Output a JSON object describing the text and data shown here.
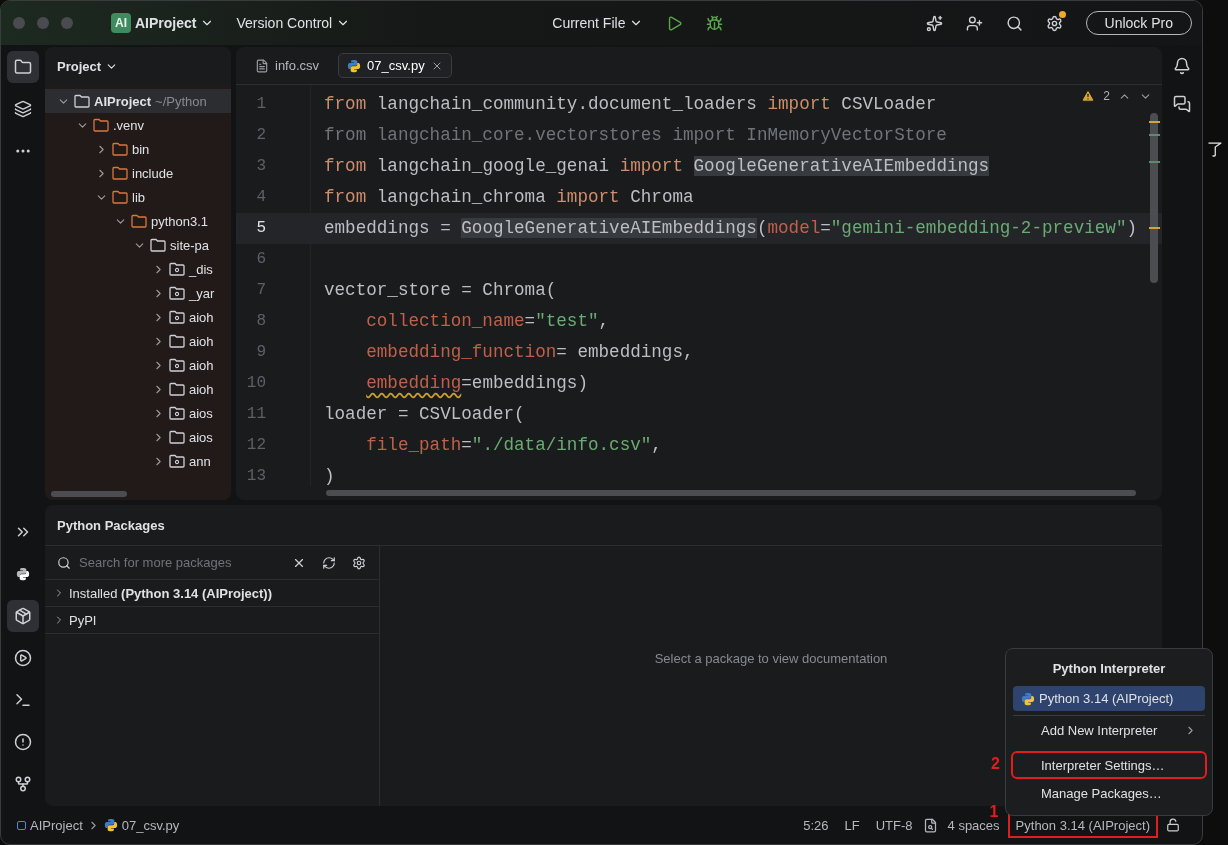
{
  "titlebar": {
    "project_badge": "AI",
    "project": "AIProject",
    "vcs": "Version Control",
    "run_config": "Current File",
    "unlock": "Unlock Pro",
    "settings_notice": true
  },
  "left_tools_top": [
    {
      "selected": true
    },
    {
      "selected": false
    },
    {
      "selected": false
    }
  ],
  "left_tools_bottom": [
    {
      "selected": false
    },
    {
      "selected": false
    },
    {
      "selected": true
    },
    {
      "selected": false
    },
    {
      "selected": false
    },
    {
      "selected": false
    },
    {
      "selected": false
    }
  ],
  "project": {
    "title": "Project",
    "tree": [
      {
        "name": "AIProject",
        "hint": "~/Python",
        "kind": "folder",
        "bold": true,
        "selected": true,
        "expanded": true,
        "children": [
          {
            "name": ".venv",
            "kind": "excluded",
            "bold": false,
            "selected": false,
            "expanded": true,
            "children": [
              {
                "name": "bin",
                "kind": "excluded",
                "bold": false,
                "selected": false,
                "expanded": false
              },
              {
                "name": "include",
                "kind": "excluded",
                "bold": false,
                "selected": false,
                "expanded": false
              },
              {
                "name": "lib",
                "kind": "excluded",
                "bold": false,
                "selected": false,
                "expanded": true,
                "children": [
                  {
                    "name": "python3.1",
                    "kind": "excluded",
                    "bold": false,
                    "selected": false,
                    "expanded": true,
                    "children": [
                      {
                        "name": "site-pa",
                        "kind": "folder",
                        "bold": false,
                        "selected": false,
                        "expanded": true,
                        "children": [
                          {
                            "name": "_dis",
                            "kind": "package",
                            "bold": false,
                            "selected": false,
                            "expanded": false
                          },
                          {
                            "name": "_yar",
                            "kind": "package",
                            "bold": false,
                            "selected": false,
                            "expanded": false
                          },
                          {
                            "name": "aioh",
                            "kind": "package",
                            "bold": false,
                            "selected": false,
                            "expanded": false
                          },
                          {
                            "name": "aioh",
                            "kind": "folder",
                            "bold": false,
                            "selected": false,
                            "expanded": false
                          },
                          {
                            "name": "aioh",
                            "kind": "package",
                            "bold": false,
                            "selected": false,
                            "expanded": false
                          },
                          {
                            "name": "aioh",
                            "kind": "folder",
                            "bold": false,
                            "selected": false,
                            "expanded": false
                          },
                          {
                            "name": "aios",
                            "kind": "package",
                            "bold": false,
                            "selected": false,
                            "expanded": false
                          },
                          {
                            "name": "aios",
                            "kind": "folder",
                            "bold": false,
                            "selected": false,
                            "expanded": false
                          },
                          {
                            "name": "ann",
                            "kind": "package",
                            "bold": false,
                            "selected": false,
                            "expanded": false
                          }
                        ]
                      }
                    ]
                  }
                ]
              }
            ]
          }
        ]
      }
    ]
  },
  "editor": {
    "tabs": [
      {
        "label": "info.csv",
        "kind": "text",
        "selected": false
      },
      {
        "label": "07_csv.py",
        "kind": "python",
        "selected": true
      }
    ],
    "warnings": "2",
    "lines": [
      {
        "number": "1",
        "current": false,
        "tokens": [
          {
            "kind": "keyword",
            "text": "from "
          },
          {
            "kind": "plain",
            "text": "langchain_community.document_loaders "
          },
          {
            "kind": "keyword",
            "text": "import "
          },
          {
            "kind": "plain",
            "text": "CSVLoader"
          }
        ]
      },
      {
        "number": "2",
        "current": false,
        "tokens": [
          {
            "kind": "unused",
            "text": "from langchain_core.vectorstores import InMemoryVectorStore"
          }
        ]
      },
      {
        "number": "3",
        "current": false,
        "tokens": [
          {
            "kind": "keyword",
            "text": "from "
          },
          {
            "kind": "plain",
            "text": "langchain_google_genai "
          },
          {
            "kind": "keyword",
            "text": "import "
          },
          {
            "kind": "highlight",
            "text": "GoogleGenerativeAIEmbeddings"
          }
        ]
      },
      {
        "number": "4",
        "current": false,
        "tokens": [
          {
            "kind": "keyword",
            "text": "from "
          },
          {
            "kind": "plain",
            "text": "langchain_chroma "
          },
          {
            "kind": "keyword",
            "text": "import "
          },
          {
            "kind": "plain",
            "text": "Chroma"
          }
        ]
      },
      {
        "number": "5",
        "current": true,
        "tokens": [
          {
            "kind": "plain",
            "text": "embeddings = "
          },
          {
            "kind": "highlight",
            "text": "GoogleGenerativeAIEmbeddings"
          },
          {
            "kind": "plain",
            "text": "("
          },
          {
            "kind": "param",
            "text": "model"
          },
          {
            "kind": "plain",
            "text": "="
          },
          {
            "kind": "string",
            "text": "\"gemini-embedding-2-preview\""
          },
          {
            "kind": "plain",
            "text": ")"
          }
        ]
      },
      {
        "number": "6",
        "current": false
      },
      {
        "number": "7",
        "current": false,
        "tokens": [
          {
            "kind": "plain",
            "text": "vector_store = Chroma("
          }
        ]
      },
      {
        "number": "8",
        "current": false,
        "tokens": [
          {
            "kind": "param",
            "text": "    collection_name"
          },
          {
            "kind": "plain",
            "text": "="
          },
          {
            "kind": "string",
            "text": "\"test\""
          },
          {
            "kind": "plain",
            "text": ","
          }
        ]
      },
      {
        "number": "9",
        "current": false,
        "tokens": [
          {
            "kind": "param",
            "text": "    embedding_function"
          },
          {
            "kind": "plain",
            "text": "= embeddings,"
          }
        ]
      },
      {
        "number": "10",
        "current": false,
        "tokens": [
          {
            "kind": "warning",
            "text": "    embedding"
          },
          {
            "kind": "plain",
            "text": "=embeddings)"
          }
        ]
      },
      {
        "number": "11",
        "current": false,
        "tokens": [
          {
            "kind": "plain",
            "text": "loader = CSVLoader("
          }
        ]
      },
      {
        "number": "12",
        "current": false,
        "tokens": [
          {
            "kind": "param",
            "text": "    file_path"
          },
          {
            "kind": "plain",
            "text": "="
          },
          {
            "kind": "string",
            "text": "\"./data/info.csv\""
          },
          {
            "kind": "plain",
            "text": ","
          }
        ]
      },
      {
        "number": "13",
        "current": false,
        "tokens": [
          {
            "kind": "plain",
            "text": ")"
          }
        ]
      }
    ]
  },
  "packages": {
    "title": "Python Packages",
    "search_placeholder": "Search for more packages",
    "groups": [
      {
        "label": "Installed **(Python 3.14 (AIProject))**",
        "expanded": false
      },
      {
        "label": "PyPI",
        "expanded": false
      }
    ],
    "empty_message": "Select a package to view documentation"
  },
  "interpreter_popup": {
    "title": "Python Interpreter",
    "items": [
      {
        "label": "Python 3.14 (AIProject)",
        "kind": "interpreter",
        "selected": true
      },
      {
        "label": "Add New Interpreter",
        "kind": "submenu",
        "selected": false
      },
      {
        "label": "Interpreter Settings…",
        "kind": "action",
        "selected": false,
        "annotation": "2"
      },
      {
        "label": "Manage Packages…",
        "kind": "action",
        "selected": false
      }
    ]
  },
  "status_bar": {
    "breadcrumbs": [
      {
        "label": "AIProject",
        "kind": "module"
      },
      {
        "label": "07_csv.py",
        "kind": "python"
      }
    ],
    "position": "5:26",
    "line_separator": "LF",
    "encoding": "UTF-8",
    "indent": "4 spaces",
    "interpreter": "Python 3.14 (AIProject)",
    "interpreter_annotation": "1"
  },
  "background_text": "了"
}
